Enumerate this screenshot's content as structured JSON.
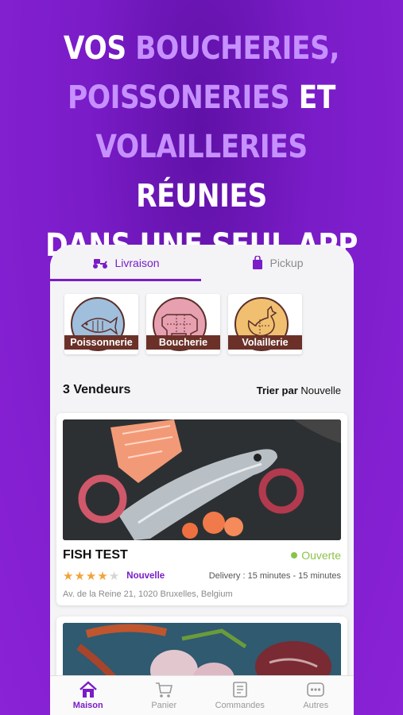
{
  "headline": {
    "line1_a": "VOS ",
    "line1_b": "BOUCHERIES,",
    "line2_a": "POISSONERIES",
    "line2_b": " ET",
    "line3_a": "VOLAILLERIES",
    "line3_b": " RÉUNIES",
    "line4": "DANS UNE SEUL APP"
  },
  "tabs": [
    {
      "label": "Livraison",
      "icon": "scooter-icon",
      "active": true
    },
    {
      "label": "Pickup",
      "icon": "shopping-bag-icon",
      "active": false
    }
  ],
  "categories": [
    {
      "label": "Poissonnerie",
      "icon": "fish-icon",
      "bg": "#9fbfdc"
    },
    {
      "label": "Boucherie",
      "icon": "cow-icon",
      "bg": "#e7a0b0"
    },
    {
      "label": "Volaillerie",
      "icon": "chicken-icon",
      "bg": "#f0c070"
    }
  ],
  "vendors": {
    "count_label": "3 Vendeurs",
    "sort_label": "Trier par",
    "sort_value": "Nouvelle"
  },
  "card": {
    "title": "FISH TEST",
    "status": "Ouverte",
    "rating": 4,
    "rating_max": 5,
    "tag": "Nouvelle",
    "delivery": "Delivery : 15 minutes - 15 minutes",
    "address": "Av. de la Reine 21, 1020 Bruxelles, Belgium"
  },
  "nav": [
    {
      "label": "Maison",
      "icon": "home-icon",
      "active": true
    },
    {
      "label": "Panier",
      "icon": "cart-icon",
      "active": false
    },
    {
      "label": "Commandes",
      "icon": "orders-icon",
      "active": false
    },
    {
      "label": "Autres",
      "icon": "more-icon",
      "active": false
    }
  ],
  "colors": {
    "brand": "#7a1cc8",
    "accent_text": "#c690ff",
    "open": "#8bc34a",
    "star": "#f0a43a"
  }
}
